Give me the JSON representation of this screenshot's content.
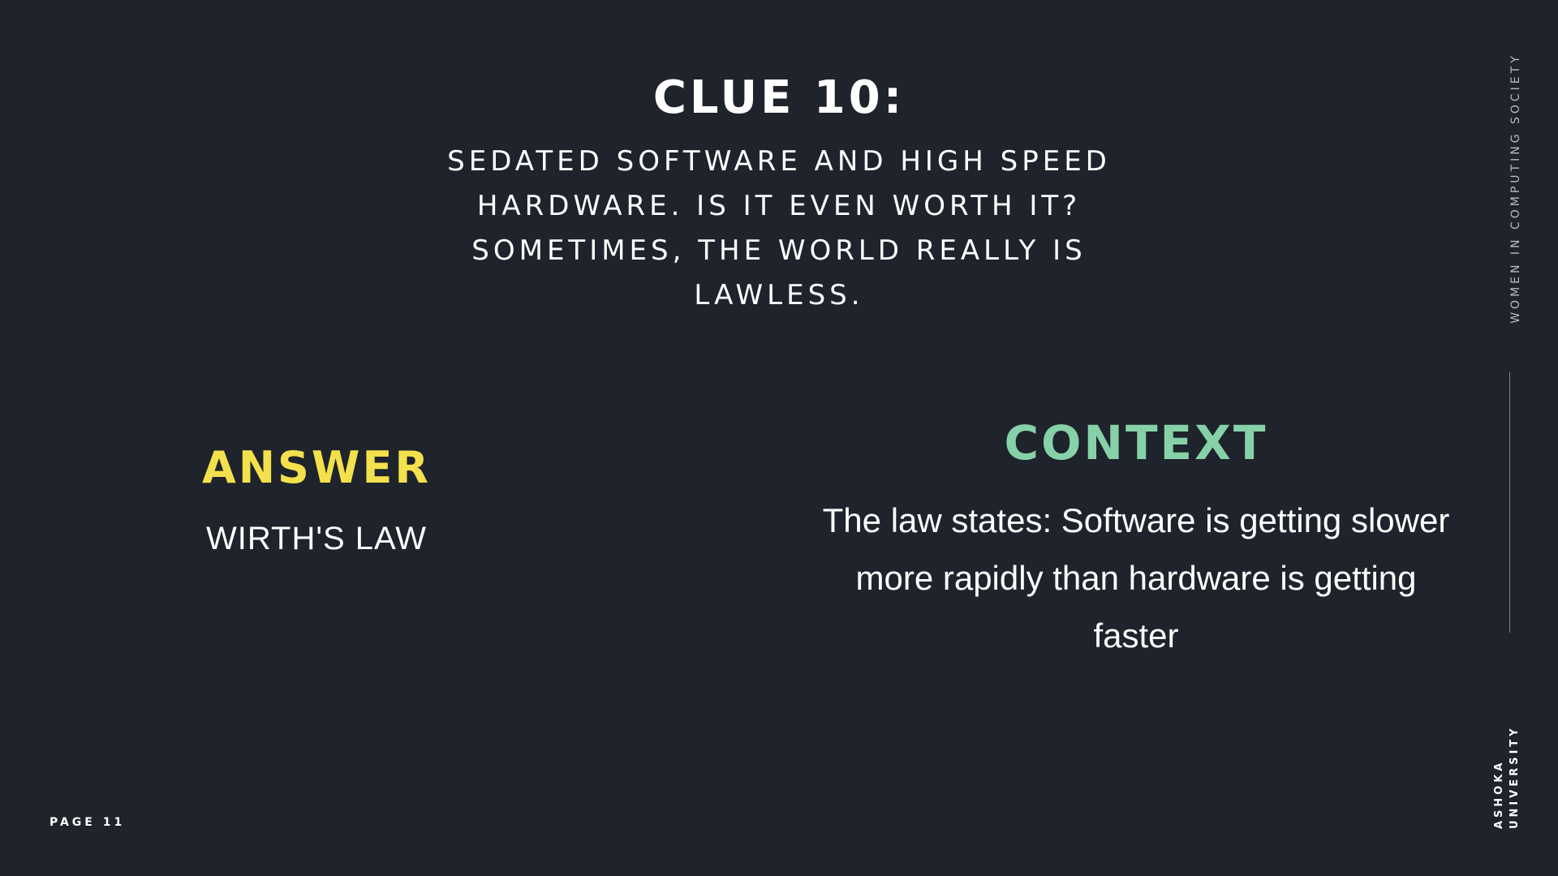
{
  "clue": {
    "title": "CLUE 10:",
    "text": "SEDATED SOFTWARE AND HIGH SPEED HARDWARE. IS IT EVEN WORTH IT? SOMETIMES, THE WORLD REALLY IS LAWLESS."
  },
  "answer": {
    "heading": "ANSWER",
    "text": "WIRTH'S LAW"
  },
  "context": {
    "heading": "CONTEXT",
    "text": "The law states: Software is getting slower more rapidly than hardware is getting faster"
  },
  "sidebar": {
    "organization": "WOMEN IN COMPUTING SOCIETY",
    "university_line1": "ASHOKA",
    "university_line2": "UNIVERSITY"
  },
  "footer": {
    "page_label": "PAGE 11"
  },
  "colors": {
    "background": "#1f232b",
    "answer_accent": "#f2e14c",
    "context_accent": "#86d1a8"
  }
}
